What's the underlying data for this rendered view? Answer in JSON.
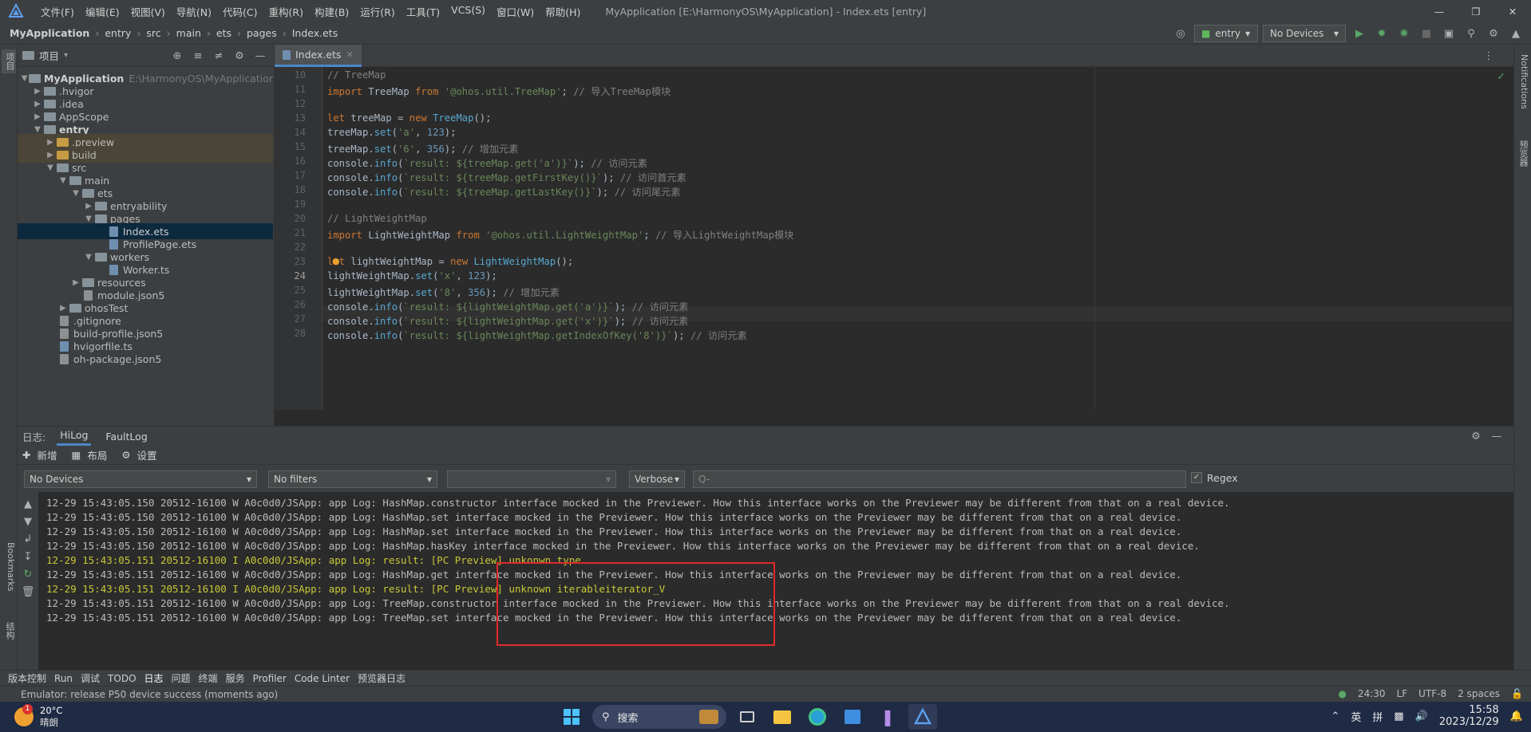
{
  "menubar": {
    "items": [
      "文件(F)",
      "编辑(E)",
      "视图(V)",
      "导航(N)",
      "代码(C)",
      "重构(R)",
      "构建(B)",
      "运行(R)",
      "工具(T)",
      "VCS(S)",
      "窗口(W)",
      "帮助(H)"
    ],
    "window_title": "MyApplication [E:\\HarmonyOS\\MyApplication] - Index.ets [entry]"
  },
  "navbar": {
    "crumbs": [
      "MyApplication",
      "entry",
      "src",
      "main",
      "ets",
      "pages",
      "Index.ets"
    ],
    "module_select": "entry",
    "device_select": "No Devices"
  },
  "left_strip": {
    "project_tab": "项目",
    "bookmarks_tab": "Bookmarks",
    "structure_tab": "结构"
  },
  "right_strip": {
    "notifications_tab": "Notifications",
    "previewer_tab": "预览器"
  },
  "project": {
    "title": "项目",
    "tree": [
      {
        "label": "MyApplication",
        "hint": "E:\\HarmonyOS\\MyApplicatior",
        "type": "module"
      },
      {
        "label": ".hvigor",
        "type": "folder"
      },
      {
        "label": ".idea",
        "type": "folder"
      },
      {
        "label": "AppScope",
        "type": "folder"
      },
      {
        "label": "entry",
        "type": "module"
      },
      {
        "label": ".preview",
        "type": "folder-orange"
      },
      {
        "label": "build",
        "type": "folder-orange"
      },
      {
        "label": "src",
        "type": "folder"
      },
      {
        "label": "main",
        "type": "folder"
      },
      {
        "label": "ets",
        "type": "folder"
      },
      {
        "label": "entryability",
        "type": "folder"
      },
      {
        "label": "pages",
        "type": "folder"
      },
      {
        "label": "Index.ets",
        "type": "file"
      },
      {
        "label": "ProfilePage.ets",
        "type": "file"
      },
      {
        "label": "workers",
        "type": "folder"
      },
      {
        "label": "Worker.ts",
        "type": "file"
      },
      {
        "label": "resources",
        "type": "folder"
      },
      {
        "label": "module.json5",
        "type": "file-json"
      },
      {
        "label": "ohosTest",
        "type": "folder"
      },
      {
        "label": ".gitignore",
        "type": "file-json"
      },
      {
        "label": "build-profile.json5",
        "type": "file-json"
      },
      {
        "label": "hvigorfile.ts",
        "type": "file"
      },
      {
        "label": "oh-package.json5",
        "type": "file-json"
      }
    ]
  },
  "editor": {
    "tab": "Index.ets",
    "line_numbers": [
      "10",
      "11",
      "12",
      "13",
      "14",
      "15",
      "16",
      "17",
      "18",
      "19",
      "20",
      "21",
      "22",
      "23",
      "24",
      "25",
      "26",
      "27",
      "28"
    ],
    "lines": [
      "// TreeMap",
      "import TreeMap from '@ohos.util.TreeMap'; // 导入TreeMap模块",
      "",
      "let treeMap = new TreeMap();",
      "treeMap.set('a', 123);",
      "treeMap.set('6', 356); // 增加元素",
      "console.info(`result: ${treeMap.get('a')}`); // 访问元素",
      "console.info(`result: ${treeMap.getFirstKey()}`); // 访问首元素",
      "console.info(`result: ${treeMap.getLastKey()}`); // 访问尾元素",
      "",
      "// LightWeightMap",
      "import LightWeightMap from '@ohos.util.LightWeightMap'; // 导入LightWeightMap模块",
      "",
      "let lightWeightMap = new LightWeightMap();",
      "lightWeightMap.set('x', 123);",
      "lightWeightMap.set('8', 356); // 增加元素",
      "console.info(`result: ${lightWeightMap.get('a')}`); // 访问元素",
      "console.info(`result: ${lightWeightMap.get('x')}`); // 访问元素",
      "console.info(`result: ${lightWeightMap.getIndexOfKey('8')}`); // 访问元素"
    ]
  },
  "log": {
    "label": "日志:",
    "tabs": [
      "HiLog",
      "FaultLog"
    ],
    "tools": [
      "新增",
      "布局",
      "设置"
    ],
    "device_filter": "No Devices",
    "filter_select": "No filters",
    "process_select": "",
    "level_select": "Verbose",
    "search_placeholder": "Q-",
    "regex_label": "Regex",
    "lines": [
      {
        "level": "W",
        "text": "12-29 15:43:05.150 20512-16100 W A0c0d0/JSApp: app Log: HashMap.constructor interface mocked in the Previewer. How this interface works on the Previewer may be different from that on a real device."
      },
      {
        "level": "W",
        "text": "12-29 15:43:05.150 20512-16100 W A0c0d0/JSApp: app Log: HashMap.set interface mocked in the Previewer. How this interface works on the Previewer may be different from that on a real device."
      },
      {
        "level": "W",
        "text": "12-29 15:43:05.150 20512-16100 W A0c0d0/JSApp: app Log: HashMap.set interface mocked in the Previewer. How this interface works on the Previewer may be different from that on a real device."
      },
      {
        "level": "W",
        "text": "12-29 15:43:05.150 20512-16100 W A0c0d0/JSApp: app Log: HashMap.hasKey interface mocked in the Previewer. How this interface works on the Previewer may be different from that on a real device."
      },
      {
        "level": "I",
        "text": "12-29 15:43:05.151 20512-16100 I A0c0d0/JSApp: app Log: result: [PC Preview] unkonwn type"
      },
      {
        "level": "W",
        "text": "12-29 15:43:05.151 20512-16100 W A0c0d0/JSApp: app Log: HashMap.get interface mocked in the Previewer. How this interface works on the Previewer may be different from that on a real device."
      },
      {
        "level": "I",
        "text": "12-29 15:43:05.151 20512-16100 I A0c0d0/JSApp: app Log: result: [PC Preview] unknown iterableiterator_V"
      },
      {
        "level": "W",
        "text": "12-29 15:43:05.151 20512-16100 W A0c0d0/JSApp: app Log: TreeMap.constructor interface mocked in the Previewer. How this interface works on the Previewer may be different from that on a real device."
      },
      {
        "level": "W",
        "text": "12-29 15:43:05.151 20512-16100 W A0c0d0/JSApp: app Log: TreeMap.set interface mocked in the Previewer. How this interface works on the Previewer may be different from that on a real device."
      }
    ]
  },
  "tooltabs": [
    "版本控制",
    "Run",
    "调试",
    "TODO",
    "日志",
    "问题",
    "终端",
    "服务",
    "Profiler",
    "Code Linter",
    "预览器日志"
  ],
  "statusbar": {
    "message": "Emulator: release P50 device success (moments ago)",
    "position": "24:30",
    "line_sep": "LF",
    "encoding": "UTF-8",
    "indent": "2 spaces"
  },
  "taskbar": {
    "weather_temp": "20°C",
    "weather_desc": "晴朗",
    "weather_badge": "1",
    "search_label": "搜索",
    "ime_lang": "英",
    "ime_mode": "拼",
    "time": "15:58",
    "date": "2023/12/29"
  },
  "colors": {
    "accent": "#4a88c7",
    "highlight_box": "#e02a2a",
    "log_info": "#c8c83a"
  }
}
